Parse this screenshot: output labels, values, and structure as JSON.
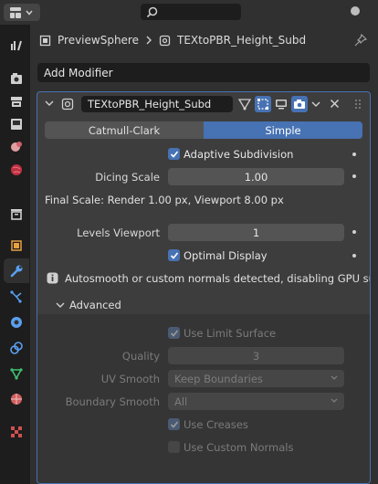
{
  "colors": {
    "accent": "#4772b3",
    "panel_bg": "#303030",
    "field_bg": "#545454"
  },
  "breadcrumb": {
    "object": "PreviewSphere",
    "modifier": "TEXtoPBR_Height_Subd"
  },
  "add_modifier_label": "Add Modifier",
  "modifier": {
    "name": "TEXtoPBR_Height_Subd",
    "type_options": [
      "Catmull-Clark",
      "Simple"
    ],
    "selected_type": "Simple",
    "adaptive_subdivision_label": "Adaptive Subdivision",
    "dicing_scale_label": "Dicing Scale",
    "dicing_scale_value": "1.00",
    "final_scale_text": "Final Scale: Render 1.00 px, Viewport 8.00 px",
    "levels_viewport_label": "Levels Viewport",
    "levels_viewport_value": "1",
    "optimal_display_label": "Optimal Display",
    "info_text": "Autosmooth or custom normals detected, disabling GPU subdi...",
    "advanced": {
      "title": "Advanced",
      "use_limit_surface_label": "Use Limit Surface",
      "quality_label": "Quality",
      "quality_value": "3",
      "uv_smooth_label": "UV Smooth",
      "uv_smooth_value": "Keep Boundaries",
      "boundary_smooth_label": "Boundary Smooth",
      "boundary_smooth_value": "All",
      "use_creases_label": "Use Creases",
      "use_custom_normals_label": "Use Custom Normals"
    }
  },
  "sidebar_tabs": [
    "tool",
    "render",
    "output",
    "view-layer",
    "scene",
    "world",
    "collection",
    "object",
    "modifiers",
    "particles",
    "physics",
    "constraints",
    "data",
    "material",
    "texture"
  ]
}
